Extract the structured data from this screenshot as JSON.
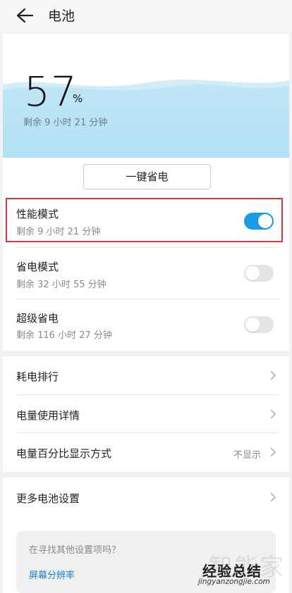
{
  "header": {
    "title": "电池"
  },
  "battery": {
    "percent": "57",
    "percent_sign": "%",
    "remaining": "剩余 9 小时 21 分钟"
  },
  "save_button": "一键省电",
  "modes": [
    {
      "title": "性能模式",
      "sub": "剩余 9 小时 21 分钟",
      "on": true
    },
    {
      "title": "省电模式",
      "sub": "剩余 32 小时 55 分钟",
      "on": false
    },
    {
      "title": "超级省电",
      "sub": "剩余 116 小时 27 分钟",
      "on": false
    }
  ],
  "menu": [
    {
      "title": "耗电排行",
      "value": ""
    },
    {
      "title": "电量使用详情",
      "value": ""
    },
    {
      "title": "电量百分比显示方式",
      "value": "不显示"
    }
  ],
  "more_settings": "更多电池设置",
  "search": {
    "question": "在寻找其他设置项吗？",
    "link": "屏幕分辨率"
  },
  "watermark": {
    "big": "智能家",
    "mid": "经验总结",
    "url": "jingyanzongjie.com"
  },
  "colors": {
    "accent": "#1a9be6",
    "highlight_border": "#cf3b3b",
    "wave": "#bfe6f5",
    "link": "#1a7fd1"
  }
}
